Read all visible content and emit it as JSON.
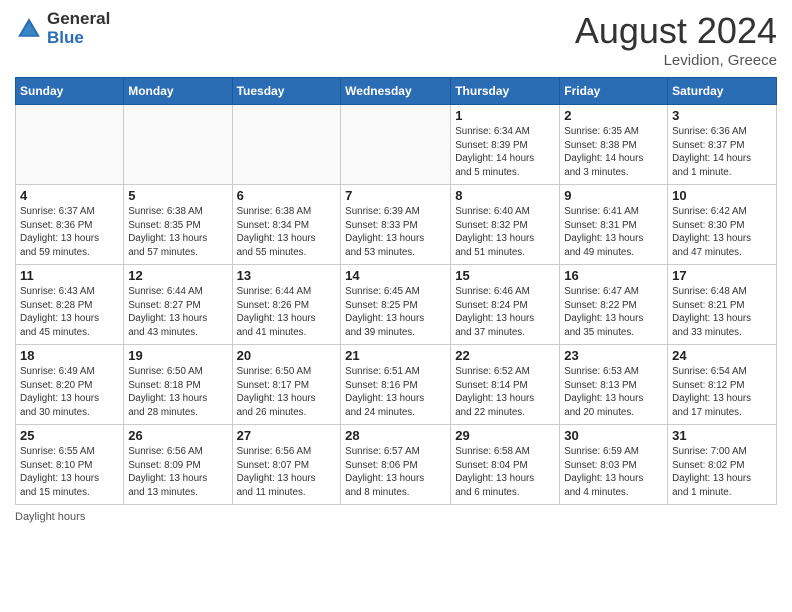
{
  "header": {
    "logo_general": "General",
    "logo_blue": "Blue",
    "month_year": "August 2024",
    "location": "Levidion, Greece"
  },
  "days_of_week": [
    "Sunday",
    "Monday",
    "Tuesday",
    "Wednesday",
    "Thursday",
    "Friday",
    "Saturday"
  ],
  "footer": {
    "note": "Daylight hours"
  },
  "weeks": [
    [
      {
        "day": "",
        "info": ""
      },
      {
        "day": "",
        "info": ""
      },
      {
        "day": "",
        "info": ""
      },
      {
        "day": "",
        "info": ""
      },
      {
        "day": "1",
        "info": "Sunrise: 6:34 AM\nSunset: 8:39 PM\nDaylight: 14 hours\nand 5 minutes."
      },
      {
        "day": "2",
        "info": "Sunrise: 6:35 AM\nSunset: 8:38 PM\nDaylight: 14 hours\nand 3 minutes."
      },
      {
        "day": "3",
        "info": "Sunrise: 6:36 AM\nSunset: 8:37 PM\nDaylight: 14 hours\nand 1 minute."
      }
    ],
    [
      {
        "day": "4",
        "info": "Sunrise: 6:37 AM\nSunset: 8:36 PM\nDaylight: 13 hours\nand 59 minutes."
      },
      {
        "day": "5",
        "info": "Sunrise: 6:38 AM\nSunset: 8:35 PM\nDaylight: 13 hours\nand 57 minutes."
      },
      {
        "day": "6",
        "info": "Sunrise: 6:38 AM\nSunset: 8:34 PM\nDaylight: 13 hours\nand 55 minutes."
      },
      {
        "day": "7",
        "info": "Sunrise: 6:39 AM\nSunset: 8:33 PM\nDaylight: 13 hours\nand 53 minutes."
      },
      {
        "day": "8",
        "info": "Sunrise: 6:40 AM\nSunset: 8:32 PM\nDaylight: 13 hours\nand 51 minutes."
      },
      {
        "day": "9",
        "info": "Sunrise: 6:41 AM\nSunset: 8:31 PM\nDaylight: 13 hours\nand 49 minutes."
      },
      {
        "day": "10",
        "info": "Sunrise: 6:42 AM\nSunset: 8:30 PM\nDaylight: 13 hours\nand 47 minutes."
      }
    ],
    [
      {
        "day": "11",
        "info": "Sunrise: 6:43 AM\nSunset: 8:28 PM\nDaylight: 13 hours\nand 45 minutes."
      },
      {
        "day": "12",
        "info": "Sunrise: 6:44 AM\nSunset: 8:27 PM\nDaylight: 13 hours\nand 43 minutes."
      },
      {
        "day": "13",
        "info": "Sunrise: 6:44 AM\nSunset: 8:26 PM\nDaylight: 13 hours\nand 41 minutes."
      },
      {
        "day": "14",
        "info": "Sunrise: 6:45 AM\nSunset: 8:25 PM\nDaylight: 13 hours\nand 39 minutes."
      },
      {
        "day": "15",
        "info": "Sunrise: 6:46 AM\nSunset: 8:24 PM\nDaylight: 13 hours\nand 37 minutes."
      },
      {
        "day": "16",
        "info": "Sunrise: 6:47 AM\nSunset: 8:22 PM\nDaylight: 13 hours\nand 35 minutes."
      },
      {
        "day": "17",
        "info": "Sunrise: 6:48 AM\nSunset: 8:21 PM\nDaylight: 13 hours\nand 33 minutes."
      }
    ],
    [
      {
        "day": "18",
        "info": "Sunrise: 6:49 AM\nSunset: 8:20 PM\nDaylight: 13 hours\nand 30 minutes."
      },
      {
        "day": "19",
        "info": "Sunrise: 6:50 AM\nSunset: 8:18 PM\nDaylight: 13 hours\nand 28 minutes."
      },
      {
        "day": "20",
        "info": "Sunrise: 6:50 AM\nSunset: 8:17 PM\nDaylight: 13 hours\nand 26 minutes."
      },
      {
        "day": "21",
        "info": "Sunrise: 6:51 AM\nSunset: 8:16 PM\nDaylight: 13 hours\nand 24 minutes."
      },
      {
        "day": "22",
        "info": "Sunrise: 6:52 AM\nSunset: 8:14 PM\nDaylight: 13 hours\nand 22 minutes."
      },
      {
        "day": "23",
        "info": "Sunrise: 6:53 AM\nSunset: 8:13 PM\nDaylight: 13 hours\nand 20 minutes."
      },
      {
        "day": "24",
        "info": "Sunrise: 6:54 AM\nSunset: 8:12 PM\nDaylight: 13 hours\nand 17 minutes."
      }
    ],
    [
      {
        "day": "25",
        "info": "Sunrise: 6:55 AM\nSunset: 8:10 PM\nDaylight: 13 hours\nand 15 minutes."
      },
      {
        "day": "26",
        "info": "Sunrise: 6:56 AM\nSunset: 8:09 PM\nDaylight: 13 hours\nand 13 minutes."
      },
      {
        "day": "27",
        "info": "Sunrise: 6:56 AM\nSunset: 8:07 PM\nDaylight: 13 hours\nand 11 minutes."
      },
      {
        "day": "28",
        "info": "Sunrise: 6:57 AM\nSunset: 8:06 PM\nDaylight: 13 hours\nand 8 minutes."
      },
      {
        "day": "29",
        "info": "Sunrise: 6:58 AM\nSunset: 8:04 PM\nDaylight: 13 hours\nand 6 minutes."
      },
      {
        "day": "30",
        "info": "Sunrise: 6:59 AM\nSunset: 8:03 PM\nDaylight: 13 hours\nand 4 minutes."
      },
      {
        "day": "31",
        "info": "Sunrise: 7:00 AM\nSunset: 8:02 PM\nDaylight: 13 hours\nand 1 minute."
      }
    ]
  ]
}
